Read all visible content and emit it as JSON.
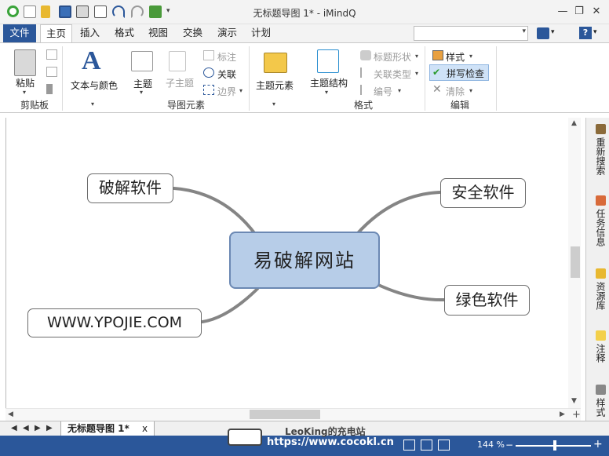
{
  "window": {
    "title": "无标题导图 1* - iMindQ",
    "controls": [
      "—",
      "❐",
      "✕"
    ]
  },
  "menu": {
    "file": "文件",
    "tabs": [
      "主页",
      "插入",
      "格式",
      "视图",
      "交换",
      "演示",
      "计划"
    ],
    "active": "主页"
  },
  "ribbon": {
    "clipboard": {
      "paste": "粘贴",
      "group": "剪贴板"
    },
    "text_color": {
      "label": "文本与颜色"
    },
    "map_elements": {
      "topic": "主题",
      "subtopic": "子主题",
      "callout": "标注",
      "relation": "关联",
      "boundary": "边界",
      "group": "导图元素"
    },
    "format": {
      "theme_elements": "主题元素",
      "topic_structure": "主题结构",
      "topic_shape": "标题形状",
      "relation_type": "关联类型",
      "numbering": "编号",
      "group": "格式"
    },
    "edit": {
      "style": "样式",
      "spellcheck": "拼写检查",
      "clear": "清除",
      "group": "编辑"
    }
  },
  "mindmap": {
    "central": "易破解网站",
    "nodes": {
      "top_left": "破解软件",
      "top_right": "安全软件",
      "bottom_right": "绿色软件",
      "bottom_left": "WWW.YPOJIE.COM"
    },
    "branch_color": "#858585"
  },
  "side_panel": {
    "tabs": [
      "重新搜索",
      "任务信息",
      "资源库",
      "注释",
      "样式"
    ]
  },
  "sheet": {
    "tab_label": "无标题导图 1*",
    "close": "x"
  },
  "status": {
    "watermark_line1": "LeoKing的充电站",
    "watermark_line2": "https://www.cocokl.cn",
    "zoom": "144 %",
    "zoom_level_percent": 50
  },
  "colors": {
    "accent": "#2b579a",
    "central_fill": "#b7cde8",
    "central_border": "#6b88b3"
  }
}
